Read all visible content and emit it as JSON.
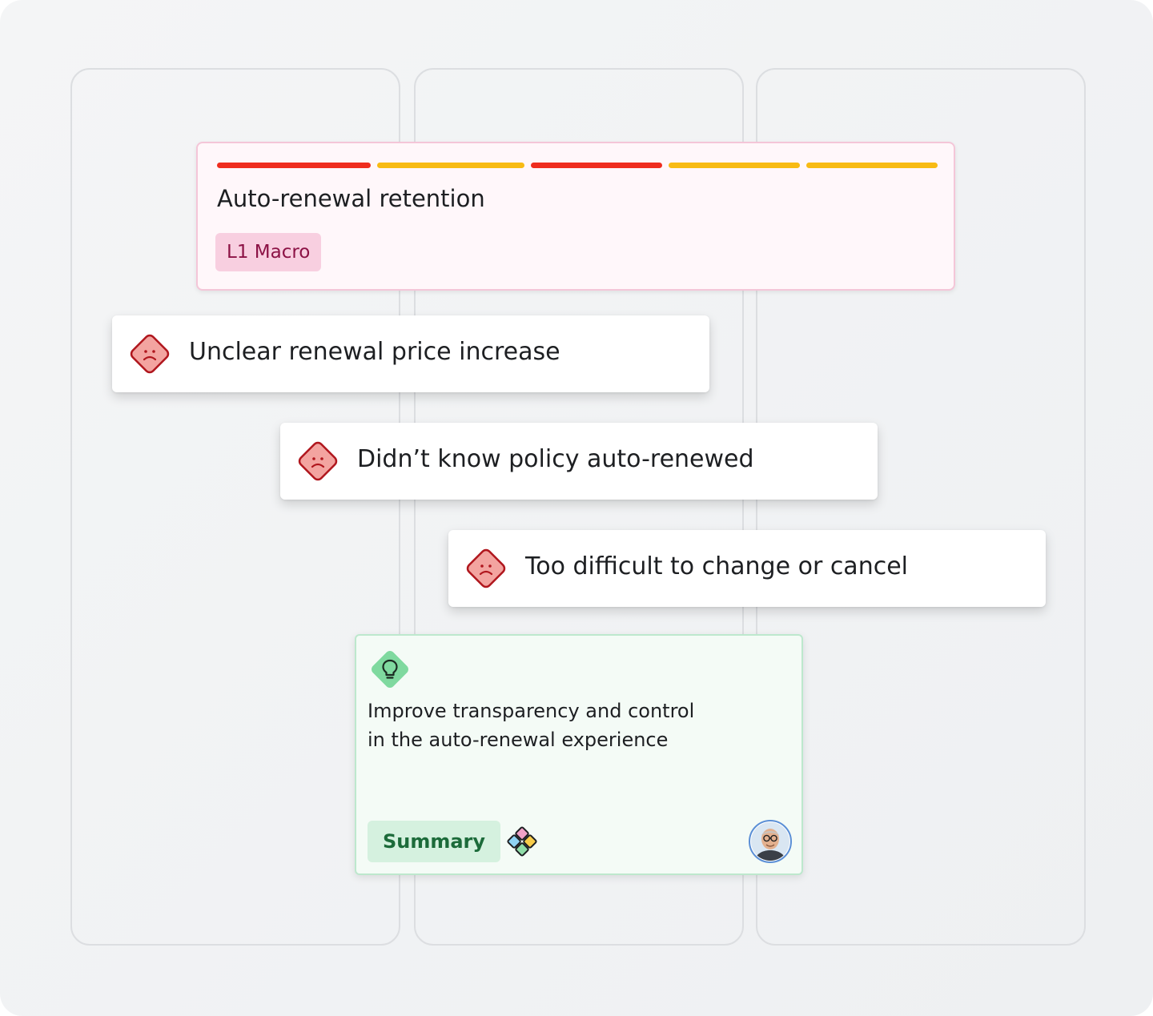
{
  "macro": {
    "title": "Auto-renewal retention",
    "tag": "L1 Macro",
    "segments": [
      {
        "status": "red",
        "color": "#ef2d1f"
      },
      {
        "status": "yellow",
        "color": "#f8bb14"
      },
      {
        "status": "red",
        "color": "#ef2d1f"
      },
      {
        "status": "yellow",
        "color": "#f8bb14"
      },
      {
        "status": "yellow",
        "color": "#f8bb14"
      }
    ]
  },
  "pain_points": [
    {
      "text": "Unclear renewal price increase",
      "icon": "sad-face-icon"
    },
    {
      "text": "Didn’t know policy auto-renewed",
      "icon": "sad-face-icon"
    },
    {
      "text": "Too difficult to change or cancel",
      "icon": "sad-face-icon"
    }
  ],
  "insight": {
    "icon": "lightbulb-icon",
    "lines": [
      "Improve transparency and control",
      "in the auto-renewal experience"
    ],
    "tag": "Summary",
    "widget_icon": "app-grid-icon",
    "avatar": "user-avatar"
  },
  "colors": {
    "macro_accent": "#8c1245",
    "pain_icon": "#f3a4a0",
    "pain_icon_stroke": "#b0161d",
    "insight_accent": "#1c6b3a"
  }
}
